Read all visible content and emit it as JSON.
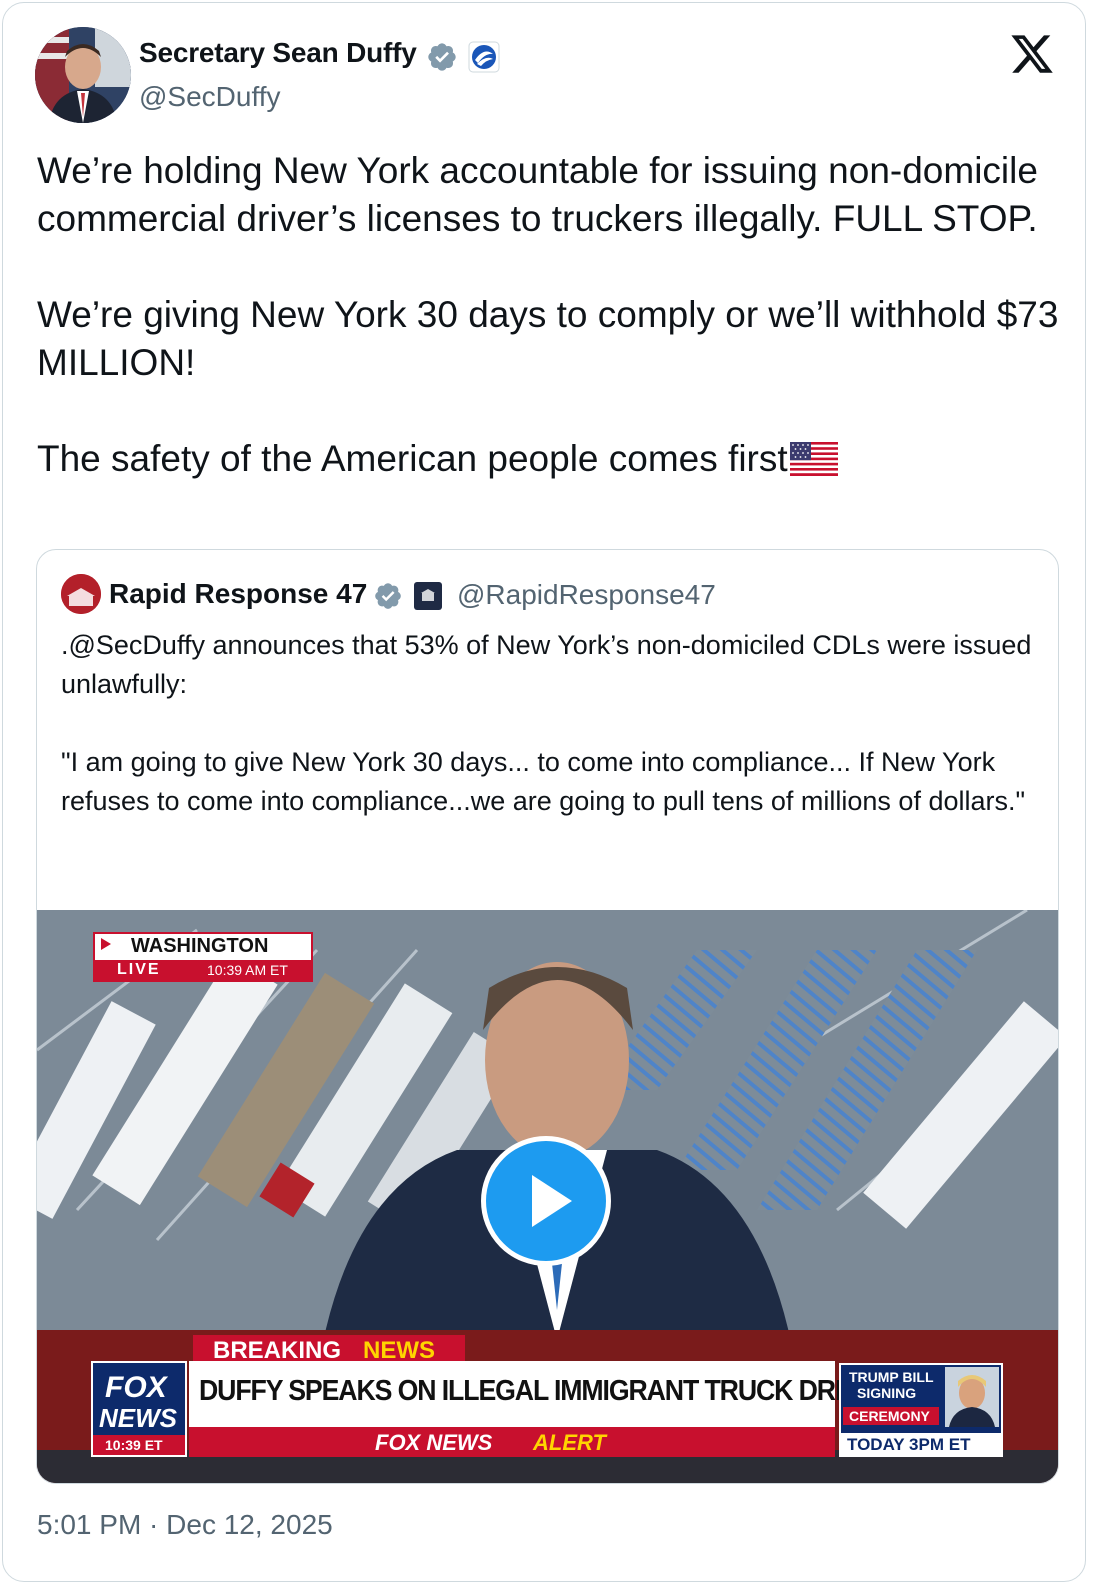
{
  "tweet": {
    "display_name": "Secretary Sean Duffy",
    "handle": "@SecDuffy",
    "text": "We’re holding New York accountable for issuing non-domicile commercial driver’s licenses to truckers illegally. FULL STOP.\n\nWe’re giving New York 30 days to comply or we’ll withhold $73 MILLION!\n\nThe safety of the American people comes first",
    "timestamp": "5:01 PM · Dec 12, 2025"
  },
  "quote": {
    "display_name": "Rapid Response 47",
    "handle": "@RapidResponse47",
    "text": ".@SecDuffy announces that 53% of New York’s non-domiciled CDLs were issued unlawfully:\n\n\"I am going to give New York 30 days... to come into compliance... If New York refuses to come into compliance...we are going to pull tens of millions of dollars.\""
  },
  "video": {
    "location": "WASHINGTON",
    "live_label": "LIVE",
    "live_time": "10:39 AM ET",
    "breaking": "BREAKING",
    "news": "NEWS",
    "headline": "DUFFY SPEAKS ON ILLEGAL IMMIGRANT TRUCK DRIVERS",
    "network_top": "FOX",
    "network_bottom": "NEWS",
    "network_time": "10:39 ET",
    "alert_left": "FOX NEWS",
    "alert_right": "ALERT",
    "side_line1": "TRUMP BILL",
    "side_line2": "SIGNING",
    "side_line3": "CEREMONY",
    "side_time": "TODAY 3PM ET"
  },
  "icons": {
    "verified": "verified-badge-icon",
    "affiliation": "dot-seal-icon",
    "x_logo": "x-logo-icon",
    "play": "play-icon"
  },
  "colors": {
    "verified_blue": "#829aab",
    "play_blue": "#1d9bf0",
    "fox_red": "#c8102e"
  }
}
